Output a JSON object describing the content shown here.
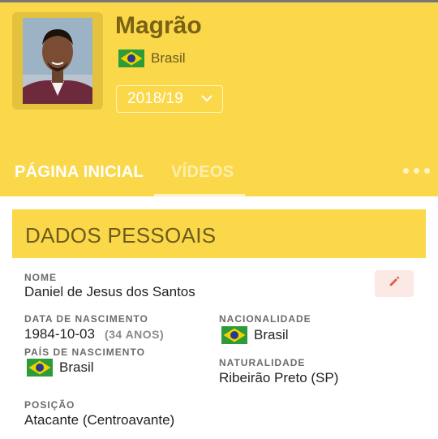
{
  "profile": {
    "name": "Magrão",
    "country": "Brasil",
    "season": "2018/19"
  },
  "tabs": [
    {
      "label": "PÁGINA INICIAL",
      "active": true
    },
    {
      "label": "VÍDEOS",
      "active": false
    }
  ],
  "section": {
    "title": "DADOS PESSOAIS"
  },
  "personal": {
    "nome_label": "NOME",
    "nome": "Daniel de Jesus dos Santos",
    "nascimento_label": "DATA DE NASCIMENTO",
    "nascimento": "1984-10-03",
    "idade": "(34 ANOS)",
    "pais_label": "PAÍS DE NASCIMENTO",
    "pais": "Brasil",
    "nacionalidade_label": "NACIONALIDADE",
    "nacionalidade": "Brasil",
    "naturalidade_label": "NATURALIDADE",
    "naturalidade": "Ribeirão Preto (SP)",
    "posicao_label": "POSIÇÃO",
    "posicao": "Atacante (Centroavante)"
  },
  "icons": {
    "edit": "pencil-icon",
    "more": "more-options-icon",
    "season_dropdown": "chevron-down-icon",
    "flag": "brazil-flag-icon"
  },
  "colors": {
    "header": "#fbd84a",
    "edit_accent": "#e35a4a",
    "flag_green": "#2d9b3a",
    "flag_yellow": "#f5d000",
    "flag_blue": "#243c8c"
  }
}
